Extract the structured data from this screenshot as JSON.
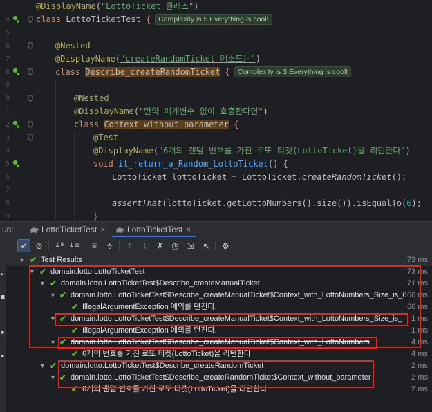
{
  "editor": {
    "lines": [
      {
        "num": "4",
        "annotation": "@DisplayName",
        "string": "\"LottoTicket 클래스\"",
        "suffix": ")"
      },
      {
        "num": "5",
        "kw": "class",
        "name": "LottoTicketTest",
        "brace": "{",
        "hint": "Complexity is 5 Everything is cool!"
      },
      {
        "num": "6"
      },
      {
        "num": "7",
        "annotation": "@Nested"
      },
      {
        "num": "8",
        "annotation": "@DisplayName",
        "string": "\"createRandomTicket 메소드는\"",
        "suffix": ")"
      },
      {
        "num": "9",
        "kw": "class",
        "name": "Describe_createRandomTicket",
        "brace": "{",
        "hint": "Complexity is 3 Everything is cool!"
      },
      {
        "num": "0"
      },
      {
        "num": "1",
        "annotation": "@Nested"
      },
      {
        "num": "2",
        "annotation": "@DisplayName",
        "string": "\"만약 매개변수 없이 호출한다면\"",
        "suffix": ")"
      },
      {
        "num": "3",
        "kw": "class",
        "name": "Context_without_parameter",
        "brace": "{"
      },
      {
        "num": "4",
        "annotation": "@Test"
      },
      {
        "num": "5",
        "annotation": "@DisplayName",
        "string": "\"6개의 랜덤 번호를 가진 로또 티켓(LottoTicket)을 리턴한다\"",
        "suffix": ")"
      },
      {
        "num": "6",
        "kw": "void",
        "name": "it_return_a_Random_LottoTicket",
        "brace": "() {"
      },
      {
        "num": "7",
        "code_a": "LottoTicket lottoTicket = LottoTicket.",
        "code_fn": "createRandomTicket",
        "code_b": "();"
      },
      {
        "num": "8"
      },
      {
        "num": "9",
        "assert_fn": "assertThat",
        "assert_a": "(lottoTicket.getLottoNumbers().size()).isEqualTo(",
        "assert_num": "6",
        "assert_b": ");"
      },
      {
        "num": "0",
        "brace_close": "}"
      }
    ]
  },
  "run": {
    "label": "un:",
    "tabs": [
      {
        "label": "LottoTicketTest",
        "close": "×"
      },
      {
        "label": "LottoTicketTest",
        "close": "×"
      }
    ]
  },
  "toolbar": {
    "icons": [
      "check-icon",
      "stop-icon",
      "sort-alpha-icon",
      "sort-duration-icon",
      "expand-all-icon",
      "collapse-all-icon",
      "prev-failed-icon",
      "next-failed-icon",
      "rerun-failed-icon",
      "history-icon",
      "import-tests-icon",
      "export-tests-icon",
      "settings-icon"
    ]
  },
  "tree": {
    "rows": [
      {
        "label": "Test Results",
        "time": "73 ms"
      },
      {
        "label": "domain.lotto.LottoTicketTest",
        "time": "73 ms"
      },
      {
        "label": "domain.lotto.LottoTicketTest$Describe_createManualTicket",
        "time": "71 ms"
      },
      {
        "label": "domain.lotto.LottoTicketTest$Describe_createManualTicket$Context_with_LottoNumbers_Size_is_6",
        "time": "66 ms"
      },
      {
        "label": "IllegalArgumentException 예외를 던진다.",
        "time": "66 ms"
      },
      {
        "label": "domain.lotto.LottoTicketTest$Describe_createManualTicket$Context_with_LottoNumbers_Size_is_less",
        "time": "1 ms"
      },
      {
        "label": "IllegalArgumentException 예외를 던진다.",
        "time": "1 ms"
      },
      {
        "label": "domain.lotto.LottoTicketTest$Describe_createManualTicket$Context_with_LottoNumbers",
        "time": "4 ms"
      },
      {
        "label": "6개의 번호를 가진 로또 티켓(LottoTicket)을 리턴한다",
        "time": "4 ms"
      },
      {
        "label": "domain.lotto.LottoTicketTest$Describe_createRandomTicket",
        "time": "2 ms"
      },
      {
        "label": "domain.lotto.LottoTicketTest$Describe_createRandomTicket$Context_without_parameter",
        "time": "2 ms"
      },
      {
        "label": "6개의 랜덤 번호를 가진 로또 티켓(LottoTicket)을 리턴한다",
        "time": "2 ms"
      }
    ]
  },
  "colors": {
    "pass": "#5fb832",
    "highlight_box": "#e0291c",
    "tab_active": "#3574f0"
  }
}
